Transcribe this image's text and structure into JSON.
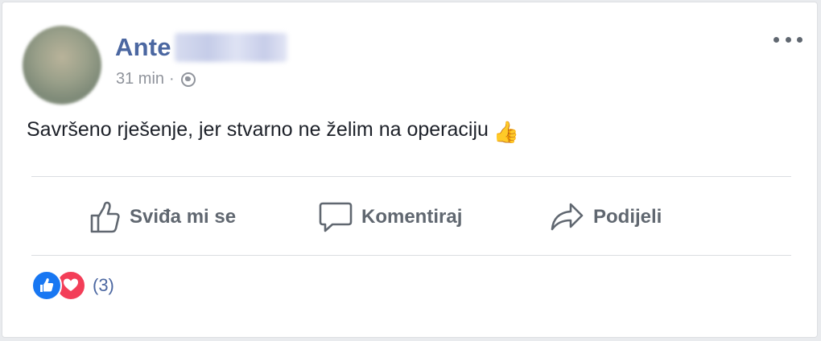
{
  "post": {
    "author_first_name": "Ante",
    "timestamp": "31 min",
    "separator": "·",
    "privacy_icon": "globe-icon",
    "text": "Savršeno rješenje, jer stvarno ne želim na operaciju",
    "emoji": "👍"
  },
  "actions": {
    "like_label": "Sviđa mi se",
    "comment_label": "Komentiraj",
    "share_label": "Podijeli"
  },
  "reactions": {
    "icons": [
      "like-reaction-icon",
      "love-reaction-icon"
    ],
    "count": "(3)"
  },
  "colors": {
    "name": "#4b67a1",
    "meta": "#90949c",
    "action": "#606770",
    "like": "#1877f2",
    "love": "#f33e58"
  }
}
